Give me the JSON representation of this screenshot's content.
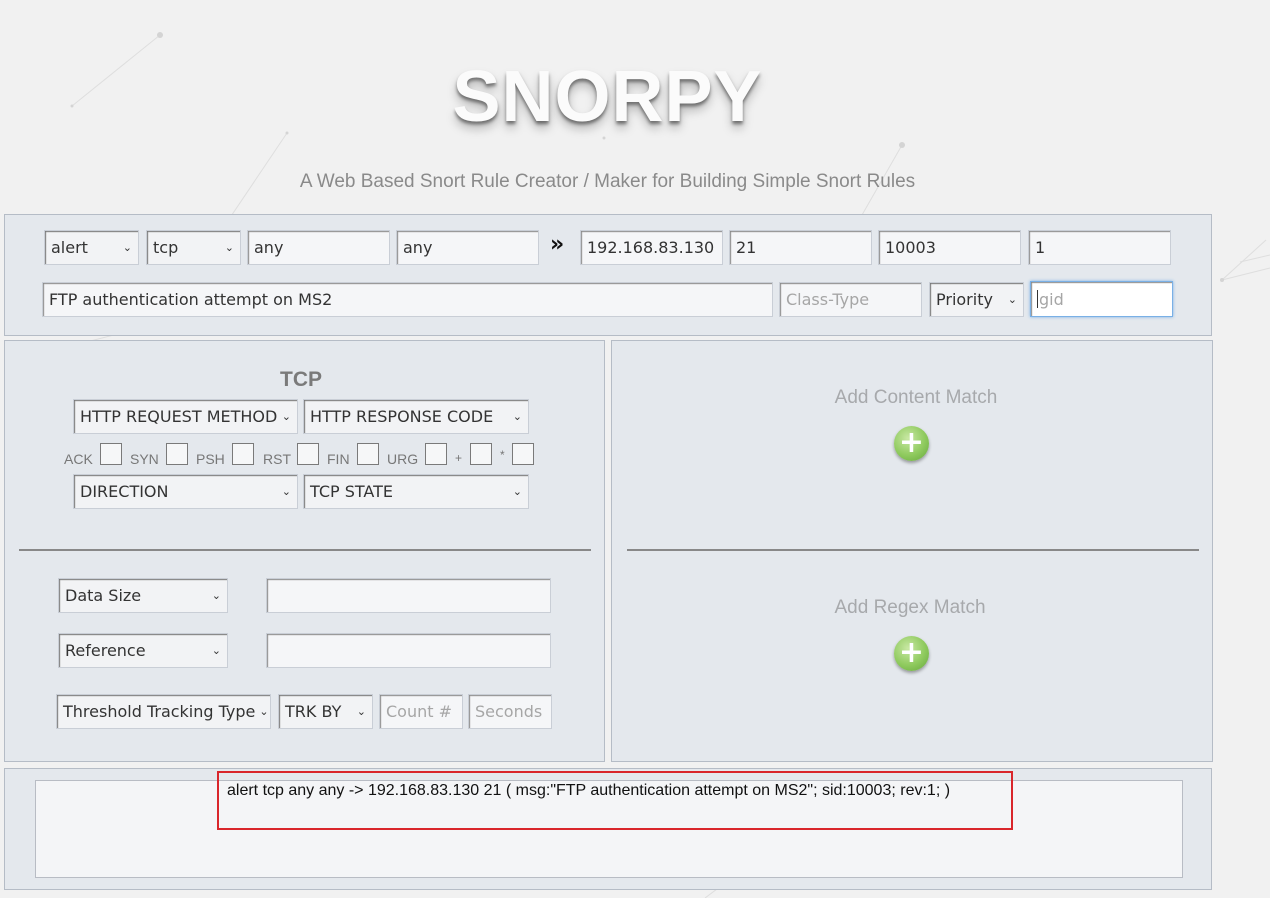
{
  "header": {
    "logo": "SNORPY",
    "tagline": "A Web Based Snort Rule Creator / Maker for Building Simple Snort Rules"
  },
  "rule_header": {
    "action": "alert",
    "protocol": "tcp",
    "src_ip": "any",
    "src_port": "any",
    "direction_icon": "»",
    "dst_ip": "192.168.83.130",
    "dst_port": "21",
    "sid": "10003",
    "rev": "1",
    "msg": "FTP authentication attempt on MS2",
    "classtype_placeholder": "Class-Type",
    "priority": "Priority",
    "gid_placeholder": "gid"
  },
  "tcp_panel": {
    "title": "TCP",
    "http_method": "HTTP REQUEST METHOD",
    "http_code": "HTTP RESPONSE CODE",
    "flags": [
      "ACK",
      "SYN",
      "PSH",
      "RST",
      "FIN",
      "URG",
      "+",
      "*"
    ],
    "direction": "DIRECTION",
    "tcp_state": "TCP STATE",
    "data_size": "Data Size",
    "reference": "Reference",
    "threshold_type": "Threshold Tracking Type",
    "track_by": "TRK BY",
    "count_placeholder": "Count #",
    "seconds_placeholder": "Seconds"
  },
  "content_panel": {
    "add_content": "Add Content Match",
    "add_regex": "Add Regex Match",
    "plus_icon": "+"
  },
  "output": {
    "rule_text": "alert tcp any any -> 192.168.83.130 21 ( msg:\"FTP authentication attempt on MS2\";  sid:10003; rev:1; )"
  },
  "colors": {
    "background": "#f1f1f1",
    "panel": "#e4e8ed",
    "highlight_border": "#d9262b",
    "focus_border": "#7ab0e6",
    "add_button": "#8fca5e"
  }
}
